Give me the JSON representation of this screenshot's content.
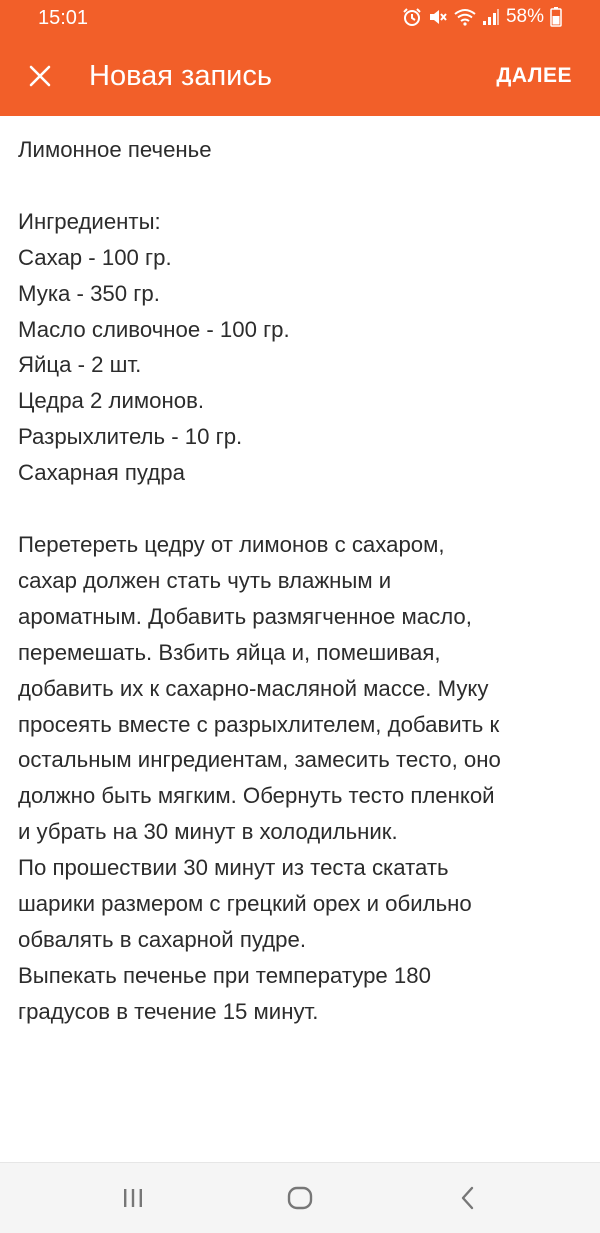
{
  "status_bar": {
    "time": "15:01",
    "battery": "58%",
    "icons": [
      "alarm-icon",
      "mute-icon",
      "wifi-icon",
      "signal-icon",
      "battery-icon"
    ]
  },
  "app_bar": {
    "close_icon": "close-icon",
    "title": "Новая запись",
    "next_label": "ДАЛЕЕ",
    "accent_color": "#f25f29"
  },
  "note": {
    "text": "Лимонное печенье\n\nИнгредиенты:\nСахар - 100 гр.\nМука - 350 гр.\nМасло сливочное - 100 гр.\nЯйца - 2 шт.\nЦедра 2 лимонов.\nРазрыхлитель - 10 гр.\nСахарная пудра\n\nПеретереть цедру от лимонов с сахаром,\nсахар должен стать чуть влажным и\nароматным. Добавить размягченное масло,\nперемешать. Взбить яйца и, помешивая,\nдобавить их к сахарно-масляной массе. Муку\nпросеять вместе с разрыхлителем, добавить к\nостальным ингредиентам, замесить тесто, оно\nдолжно быть мягким. Обернуть тесто пленкой\nи убрать на 30 минут в холодильник.\nПо прошествии 30 минут из теста скатать\nшарики размером с грецкий орех и обильно\nобвалять в сахарной пудре.\nВыпекать печенье при температуре 180\nградусов в течение 15 минут."
  },
  "nav_bar": {
    "icons": [
      "recent-apps-icon",
      "home-icon",
      "back-icon"
    ]
  }
}
